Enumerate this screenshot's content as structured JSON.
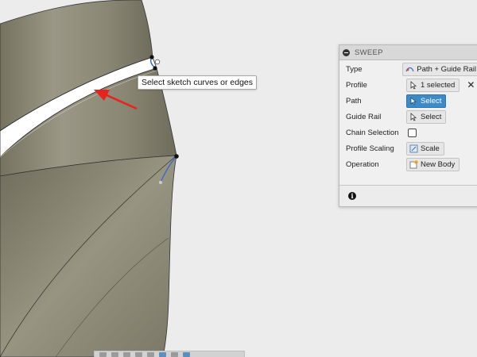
{
  "viewport": {
    "tooltip": "Select sketch curves or edges"
  },
  "sweep_panel": {
    "title": "SWEEP",
    "rows": {
      "type": {
        "label": "Type",
        "value": "Path + Guide Rail",
        "icon": "path-guide-rail-icon"
      },
      "profile": {
        "label": "Profile",
        "value": "1 selected",
        "icon": "cursor-select-icon",
        "clear_symbol": "✕"
      },
      "path": {
        "label": "Path",
        "value": "Select",
        "icon": "cursor-select-icon",
        "active": true
      },
      "guide_rail": {
        "label": "Guide Rail",
        "value": "Select",
        "icon": "cursor-select-icon"
      },
      "chain_selection": {
        "label": "Chain Selection",
        "checked": false
      },
      "profile_scaling": {
        "label": "Profile Scaling",
        "value": "Scale",
        "icon": "scale-icon"
      },
      "operation": {
        "label": "Operation",
        "value": "New Body",
        "icon": "new-body-icon"
      }
    },
    "info_glyph": "i"
  },
  "colors": {
    "accent": "#3d8ac7",
    "body_surface": "#8f8c7b",
    "background": "#ececec",
    "arrow": "#e8231f"
  }
}
